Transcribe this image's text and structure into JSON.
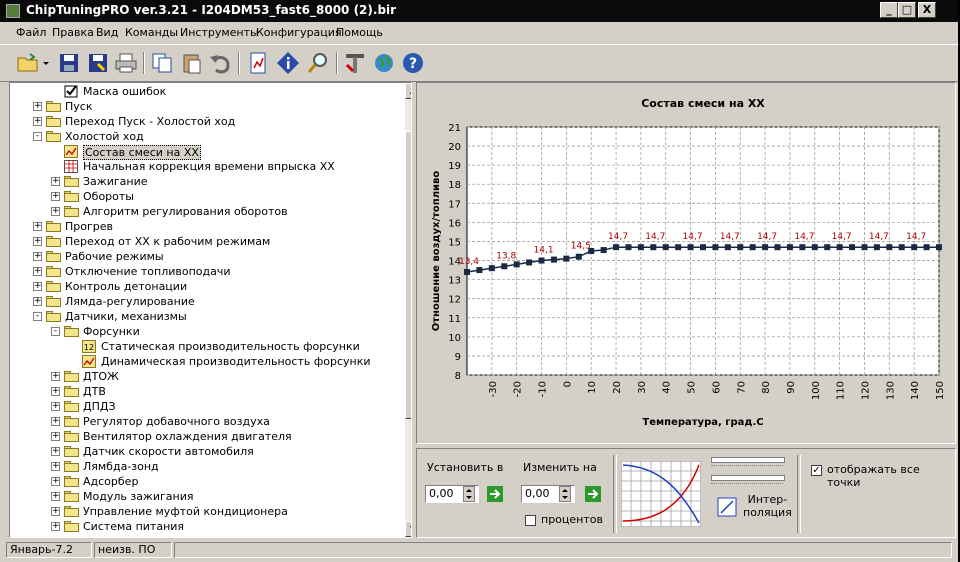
{
  "window": {
    "title": "ChipTuningPRO ver.3.21 - I204DM53_fast6_8000 (2).bir",
    "min_label": "_",
    "max_label": "□",
    "close_label": "X"
  },
  "menu": [
    "Файл",
    "Правка",
    "Вид",
    "Команды",
    "Инструменты",
    "Конфигурация",
    "Помощь"
  ],
  "toolbar_icons": [
    "open-folder-icon",
    "save-icon",
    "save-as-icon",
    "print-icon",
    "copy-icon",
    "paste-icon",
    "undo-icon",
    "document-icon",
    "info-icon",
    "search-icon",
    "tools-icon",
    "globe-icon",
    "help-icon"
  ],
  "tree": {
    "items": [
      {
        "label": "Маска ошибок",
        "level": 2,
        "type": "check",
        "expander": ""
      },
      {
        "label": "Пуск",
        "level": 1,
        "type": "folder",
        "expander": "+"
      },
      {
        "label": "Переход Пуск - Холостой ход",
        "level": 1,
        "type": "folder",
        "expander": "+"
      },
      {
        "label": "Холостой ход",
        "level": 1,
        "type": "folder-open",
        "expander": "-"
      },
      {
        "label": "Состав смеси на ХХ",
        "level": 2,
        "type": "chart",
        "expander": "",
        "selected": true
      },
      {
        "label": "Начальная коррекция времени впрыска ХХ",
        "level": 2,
        "type": "table",
        "expander": ""
      },
      {
        "label": "Зажигание",
        "level": 2,
        "type": "folder",
        "expander": "+"
      },
      {
        "label": "Обороты",
        "level": 2,
        "type": "folder",
        "expander": "+"
      },
      {
        "label": "Алгоритм регулирования оборотов",
        "level": 2,
        "type": "folder",
        "expander": "+"
      },
      {
        "label": "Прогрев",
        "level": 1,
        "type": "folder",
        "expander": "+"
      },
      {
        "label": "Переход от ХХ к рабочим режимам",
        "level": 1,
        "type": "folder",
        "expander": "+"
      },
      {
        "label": "Рабочие режимы",
        "level": 1,
        "type": "folder",
        "expander": "+"
      },
      {
        "label": "Отключение топливоподачи",
        "level": 1,
        "type": "folder",
        "expander": "+"
      },
      {
        "label": "Контроль детонации",
        "level": 1,
        "type": "folder",
        "expander": "+"
      },
      {
        "label": "Лямда-регулирование",
        "level": 1,
        "type": "folder",
        "expander": "+"
      },
      {
        "label": "Датчики, механизмы",
        "level": 1,
        "type": "folder-open",
        "expander": "-"
      },
      {
        "label": "Форсунки",
        "level": 2,
        "type": "folder-open",
        "expander": "-"
      },
      {
        "label": "Статическая производительность форсунки",
        "level": 3,
        "type": "num",
        "expander": ""
      },
      {
        "label": "Динамическая производительность форсунки",
        "level": 3,
        "type": "chart",
        "expander": ""
      },
      {
        "label": "ДТОЖ",
        "level": 2,
        "type": "folder",
        "expander": "+"
      },
      {
        "label": "ДТВ",
        "level": 2,
        "type": "folder",
        "expander": "+"
      },
      {
        "label": "ДПДЗ",
        "level": 2,
        "type": "folder",
        "expander": "+"
      },
      {
        "label": "Регулятор добавочного воздуха",
        "level": 2,
        "type": "folder",
        "expander": "+"
      },
      {
        "label": "Вентилятор охлаждения двигателя",
        "level": 2,
        "type": "folder",
        "expander": "+"
      },
      {
        "label": "Датчик скорости автомобиля",
        "level": 2,
        "type": "folder",
        "expander": "+"
      },
      {
        "label": "Лямбда-зонд",
        "level": 2,
        "type": "folder",
        "expander": "+"
      },
      {
        "label": "Адсорбер",
        "level": 2,
        "type": "folder",
        "expander": "+"
      },
      {
        "label": "Модуль зажигания",
        "level": 2,
        "type": "folder",
        "expander": "+"
      },
      {
        "label": "Управление муфтой кондиционера",
        "level": 2,
        "type": "folder",
        "expander": "+"
      },
      {
        "label": "Система питания",
        "level": 2,
        "type": "folder",
        "expander": "+"
      }
    ],
    "num_icon_text": "12"
  },
  "chart_data": {
    "type": "line",
    "title": "Состав смеси на ХХ",
    "xlabel": "Температура, град.С",
    "ylabel": "Отношение воздух/топливо",
    "xlim": [
      -40,
      150
    ],
    "ylim": [
      8,
      21
    ],
    "x_ticks": [
      -30,
      -20,
      -10,
      0,
      10,
      20,
      30,
      40,
      50,
      60,
      70,
      80,
      90,
      100,
      110,
      120,
      130,
      140,
      150
    ],
    "y_ticks": [
      8,
      9,
      10,
      11,
      12,
      13,
      14,
      15,
      16,
      17,
      18,
      19,
      20,
      21
    ],
    "grid": true,
    "x": [
      -40,
      -35,
      -30,
      -25,
      -20,
      -15,
      -10,
      -5,
      0,
      5,
      10,
      15,
      20,
      25,
      30,
      35,
      40,
      45,
      50,
      55,
      60,
      65,
      70,
      75,
      80,
      85,
      90,
      95,
      100,
      105,
      110,
      115,
      120,
      125,
      130,
      135,
      140,
      145,
      150
    ],
    "y": [
      13.4,
      13.5,
      13.6,
      13.7,
      13.8,
      13.9,
      14.0,
      14.05,
      14.1,
      14.2,
      14.5,
      14.55,
      14.7,
      14.7,
      14.7,
      14.7,
      14.7,
      14.7,
      14.7,
      14.7,
      14.7,
      14.7,
      14.7,
      14.7,
      14.7,
      14.7,
      14.7,
      14.7,
      14.7,
      14.7,
      14.7,
      14.7,
      14.7,
      14.7,
      14.7,
      14.7,
      14.7,
      14.7,
      14.7
    ],
    "data_labels": [
      {
        "x": -40,
        "y": 13.4,
        "text": "13,4"
      },
      {
        "x": -25,
        "y": 13.7,
        "text": "13,8"
      },
      {
        "x": -10,
        "y": 14.0,
        "text": "14,1"
      },
      {
        "x": 5,
        "y": 14.2,
        "text": "14,5"
      },
      {
        "x": 20,
        "y": 14.7,
        "text": "14,7"
      },
      {
        "x": 35,
        "y": 14.7,
        "text": "14,7"
      },
      {
        "x": 50,
        "y": 14.7,
        "text": "14,7"
      },
      {
        "x": 65,
        "y": 14.7,
        "text": "14,7"
      },
      {
        "x": 80,
        "y": 14.7,
        "text": "14,7"
      },
      {
        "x": 95,
        "y": 14.7,
        "text": "14,7"
      },
      {
        "x": 110,
        "y": 14.7,
        "text": "14,7"
      },
      {
        "x": 125,
        "y": 14.7,
        "text": "14,7"
      },
      {
        "x": 140,
        "y": 14.7,
        "text": "14,7"
      }
    ],
    "colors": {
      "line": "#1a2a44",
      "marker": "#1a2a44",
      "label": "#b00000",
      "grid": "#a0a0a0",
      "plot_bg": "#ffffff"
    }
  },
  "controls": {
    "set_label": "Установить в",
    "set_value": "0,00",
    "change_label": "Изменить на",
    "change_value": "0,00",
    "percent_label": "процентов",
    "percent_checked": false,
    "interp_label_1": "Интер-",
    "interp_label_2": "поляция",
    "show_all_label": "отображать все точки",
    "show_all_checked": true,
    "check_mark": "✓"
  },
  "statusbar": {
    "left": "Январь-7.2",
    "middle": "неизв. ПО"
  }
}
